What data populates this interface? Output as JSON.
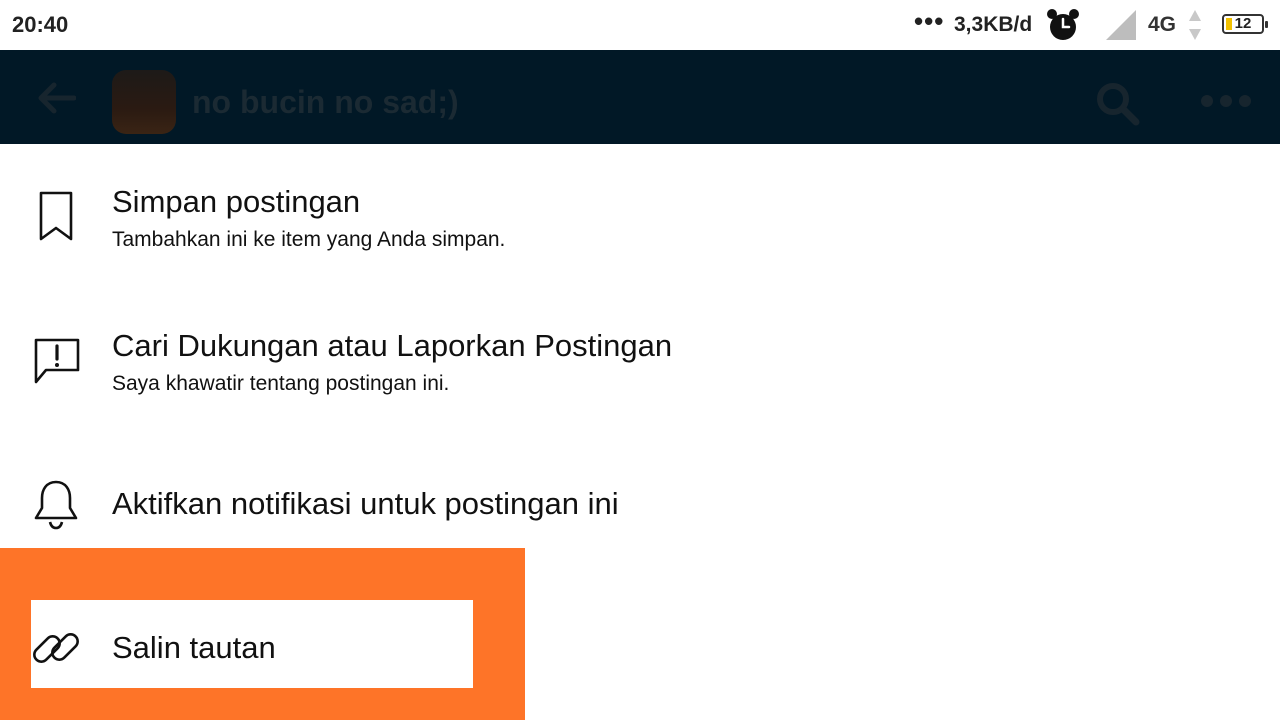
{
  "status_bar": {
    "time": "20:40",
    "dots": "•••",
    "network_speed": "3,3KB/d",
    "network_type": "4G",
    "battery_level": "12",
    "icons": [
      "alarm-icon",
      "signal-icon",
      "data-arrows-icon",
      "battery-icon"
    ]
  },
  "header": {
    "title": "no bucin no sad;)",
    "icons": [
      "back-arrow-icon",
      "search-icon",
      "more-icon"
    ]
  },
  "menu": {
    "items": [
      {
        "title": "Simpan postingan",
        "subtitle": "Tambahkan ini ke item yang Anda simpan.",
        "icon": "bookmark-icon"
      },
      {
        "title": "Cari Dukungan atau Laporkan Postingan",
        "subtitle": "Saya khawatir tentang postingan ini.",
        "icon": "report-icon"
      },
      {
        "title": "Aktifkan notifikasi untuk postingan ini",
        "icon": "bell-icon"
      },
      {
        "title": "Salin tautan",
        "icon": "link-icon"
      }
    ]
  },
  "colors": {
    "header_bg": "#011826",
    "highlight": "#fe7428",
    "battery": "#f2c100"
  }
}
